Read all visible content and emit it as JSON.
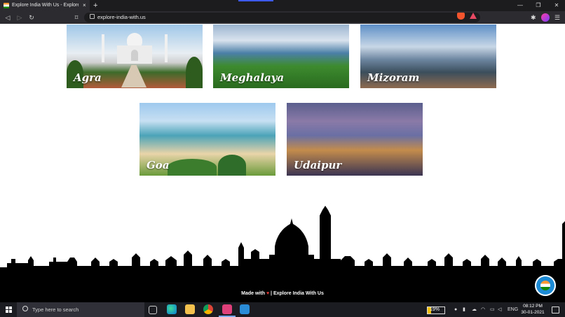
{
  "browser": {
    "tab_title": "Explore India With Us - Explore the",
    "tab_close": "×",
    "new_tab": "+",
    "url": "explore-india-with.us",
    "back": "◁",
    "forward": "▷",
    "reload": "↻",
    "bookmark": "⌑",
    "minimize": "—",
    "maximize": "❐",
    "close": "✕",
    "extensions_icon": "✱",
    "menu_icon": "☰"
  },
  "destinations": [
    {
      "label": "Agra"
    },
    {
      "label": "Meghalaya"
    },
    {
      "label": "Mizoram"
    },
    {
      "label": "Goa"
    },
    {
      "label": "Udaipur"
    }
  ],
  "footer": {
    "made_with": "Made with",
    "heart": "♥",
    "separator": "|",
    "site_name": "Explore India With Us"
  },
  "taskbar": {
    "search_placeholder": "Type here to search",
    "battery_percent": "19%",
    "battery_level": 0.19,
    "language": "ENG",
    "time": "08:12 PM",
    "date": "30-01-2021"
  },
  "colors": {
    "accent": "#1d8ad6",
    "heart": "#e53935",
    "chrome_dark": "#2b2b30"
  }
}
